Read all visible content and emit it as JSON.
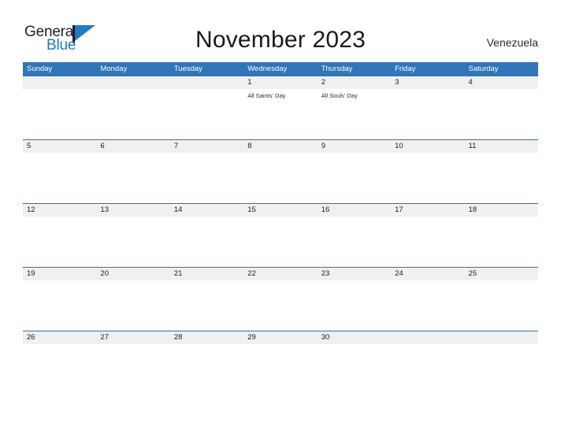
{
  "brand": {
    "name_part1": "General",
    "name_part2": "Blue",
    "accent_color": "#1f7ac0"
  },
  "header": {
    "title": "November 2023",
    "country": "Venezuela"
  },
  "theme": {
    "header_blue": "#3075b8",
    "row_line_blue": "#2e74b5",
    "band_gray": "#f0f0f0"
  },
  "calendar": {
    "weekdays": [
      "Sunday",
      "Monday",
      "Tuesday",
      "Wednesday",
      "Thursday",
      "Friday",
      "Saturday"
    ],
    "weeks": [
      [
        {
          "day": "",
          "event": ""
        },
        {
          "day": "",
          "event": ""
        },
        {
          "day": "",
          "event": ""
        },
        {
          "day": "1",
          "event": "All Saints' Day"
        },
        {
          "day": "2",
          "event": "All Souls' Day"
        },
        {
          "day": "3",
          "event": ""
        },
        {
          "day": "4",
          "event": ""
        }
      ],
      [
        {
          "day": "5",
          "event": ""
        },
        {
          "day": "6",
          "event": ""
        },
        {
          "day": "7",
          "event": ""
        },
        {
          "day": "8",
          "event": ""
        },
        {
          "day": "9",
          "event": ""
        },
        {
          "day": "10",
          "event": ""
        },
        {
          "day": "11",
          "event": ""
        }
      ],
      [
        {
          "day": "12",
          "event": ""
        },
        {
          "day": "13",
          "event": ""
        },
        {
          "day": "14",
          "event": ""
        },
        {
          "day": "15",
          "event": ""
        },
        {
          "day": "16",
          "event": ""
        },
        {
          "day": "17",
          "event": ""
        },
        {
          "day": "18",
          "event": ""
        }
      ],
      [
        {
          "day": "19",
          "event": ""
        },
        {
          "day": "20",
          "event": ""
        },
        {
          "day": "21",
          "event": ""
        },
        {
          "day": "22",
          "event": ""
        },
        {
          "day": "23",
          "event": ""
        },
        {
          "day": "24",
          "event": ""
        },
        {
          "day": "25",
          "event": ""
        }
      ],
      [
        {
          "day": "26",
          "event": ""
        },
        {
          "day": "27",
          "event": ""
        },
        {
          "day": "28",
          "event": ""
        },
        {
          "day": "29",
          "event": ""
        },
        {
          "day": "30",
          "event": ""
        },
        {
          "day": "",
          "event": ""
        },
        {
          "day": "",
          "event": ""
        }
      ]
    ]
  }
}
